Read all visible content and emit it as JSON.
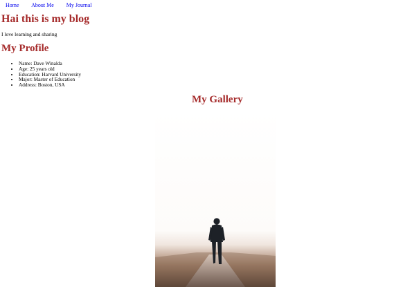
{
  "nav": {
    "links": [
      "Home",
      "About Me",
      "My Journal"
    ]
  },
  "blog": {
    "title": "Hai this is my blog",
    "tagline": "I love learning and sharing"
  },
  "profile": {
    "heading": "My Profile",
    "items": [
      "Name: Dave Winalda",
      "Age: 25 years old",
      "Education: Harvard University",
      "Major: Master of Education",
      "Address: Boston, USA"
    ]
  },
  "gallery": {
    "heading": "My Gallery"
  }
}
